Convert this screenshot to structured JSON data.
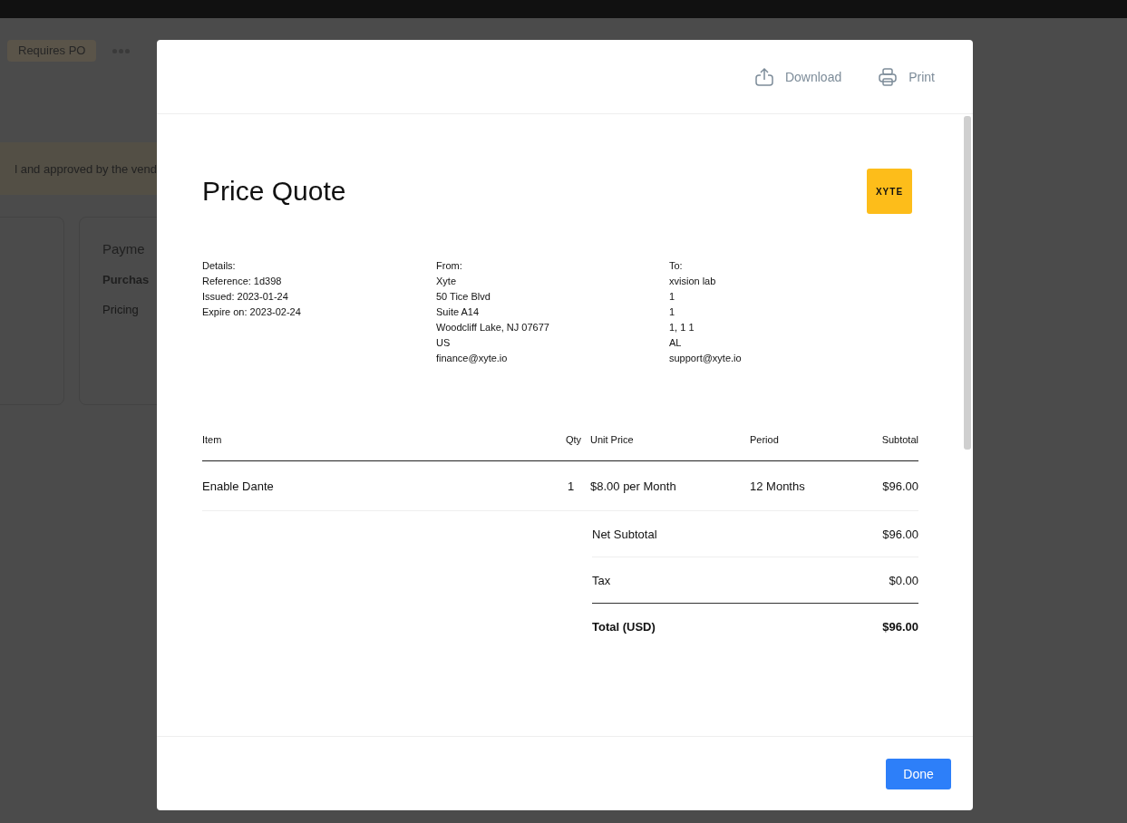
{
  "background": {
    "badge": "Requires PO",
    "banner_text": "l and approved by the vend",
    "card": {
      "title": "Payme",
      "subtitle": "Purchas",
      "line": "Pricing"
    }
  },
  "dialog": {
    "actions": [
      {
        "kind": "download",
        "label": "Download"
      },
      {
        "kind": "print",
        "label": "Print"
      }
    ],
    "title": "Price Quote",
    "logo": "XYTE",
    "columns": [
      {
        "heading": "Details:",
        "lines": [
          "Reference: 1d398",
          "Issued: 2023-01-24",
          "Expire on: 2023-02-24"
        ]
      },
      {
        "heading": "From:",
        "lines": [
          "Xyte",
          "50 Tice Blvd",
          "Suite A14",
          "Woodcliff Lake, NJ 07677",
          "US",
          "finance@xyte.io"
        ]
      },
      {
        "heading": "To:",
        "lines": [
          "xvision lab",
          "1",
          "1",
          "1, 1 1",
          "AL",
          "support@xyte.io"
        ]
      }
    ],
    "table": {
      "columns": [
        "Item",
        "Qty",
        "Unit Price",
        "Period",
        "Subtotal"
      ],
      "rows": [
        [
          "Enable Dante",
          "1",
          "$8.00 per Month",
          "12 Months",
          "$96.00"
        ]
      ]
    },
    "totals": [
      {
        "label": "Net Subtotal",
        "value": "$96.00",
        "bold": false
      },
      {
        "label": "Tax",
        "value": "$0.00",
        "bold": false
      },
      {
        "label": "Total (USD)",
        "value": "$96.00",
        "bold": true
      }
    ],
    "done": "Done"
  }
}
